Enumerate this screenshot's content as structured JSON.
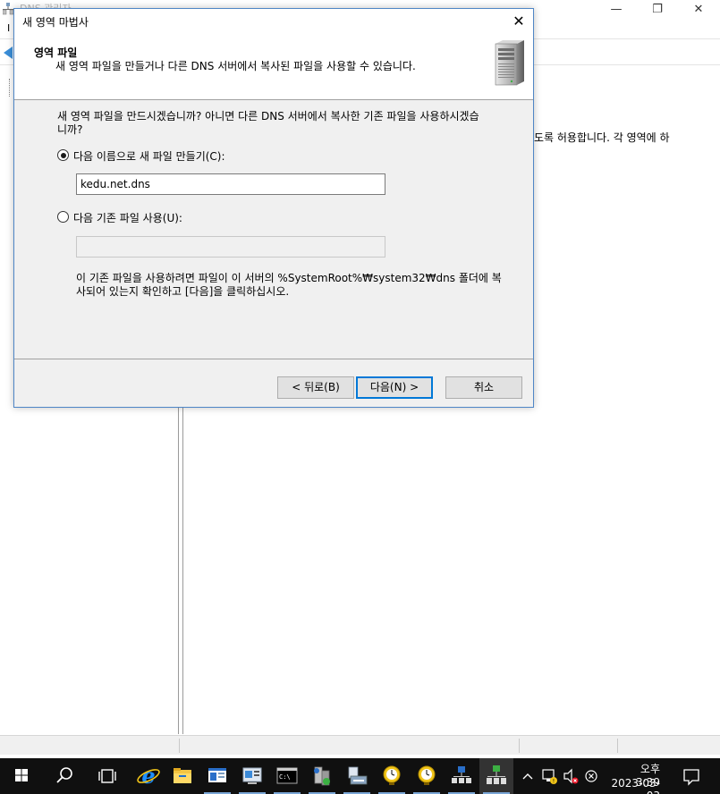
{
  "background_window": {
    "title": "DNS 관리자",
    "menu_first": "I",
    "right_pane_text": "도록 허용합니다. 각 영역에 하",
    "controls": {
      "minimize": "—",
      "maximize": "❐",
      "close": "✕"
    }
  },
  "wizard": {
    "title": "새 영역 마법사",
    "close_label": "✕",
    "header": {
      "title": "영역 파일",
      "subtitle": "새 영역 파일을 만들거나 다른 DNS 서버에서 복사된 파일을 사용할 수 있습니다."
    },
    "question": "새 영역 파일을 만드시겠습니까? 아니면 다른 DNS 서버에서 복사한 기존 파일을 사용하시겠습니까?",
    "option_new": {
      "label": "다음 이름으로 새 파일 만들기(C):",
      "selected": true,
      "value": "kedu.net.dns"
    },
    "option_existing": {
      "label": "다음 기존 파일 사용(U):",
      "selected": false,
      "value": ""
    },
    "note": "이 기존 파일을 사용하려면 파일이 이 서버의 %SystemRoot%₩system32₩dns 폴더에 복사되어 있는지 확인하고 [다음]을 클릭하십시오.",
    "buttons": {
      "back": "< 뒤로(B)",
      "next": "다음(N) >",
      "cancel": "취소"
    }
  },
  "taskbar": {
    "time": "오후 3:39",
    "date": "2023-03-03",
    "icons": [
      "windows-start-icon",
      "search-icon",
      "task-view-icon",
      "internet-explorer-icon",
      "file-explorer-icon",
      "server-manager-icon",
      "computer-management-icon",
      "command-prompt-icon",
      "dns-manager-icon",
      "print-management-icon",
      "scheduler-icon",
      "scheduler-icon",
      "network-icon",
      "dns-manager-icon"
    ],
    "colors": {
      "taskbar": "#101010",
      "accent": "#0078d7"
    }
  }
}
